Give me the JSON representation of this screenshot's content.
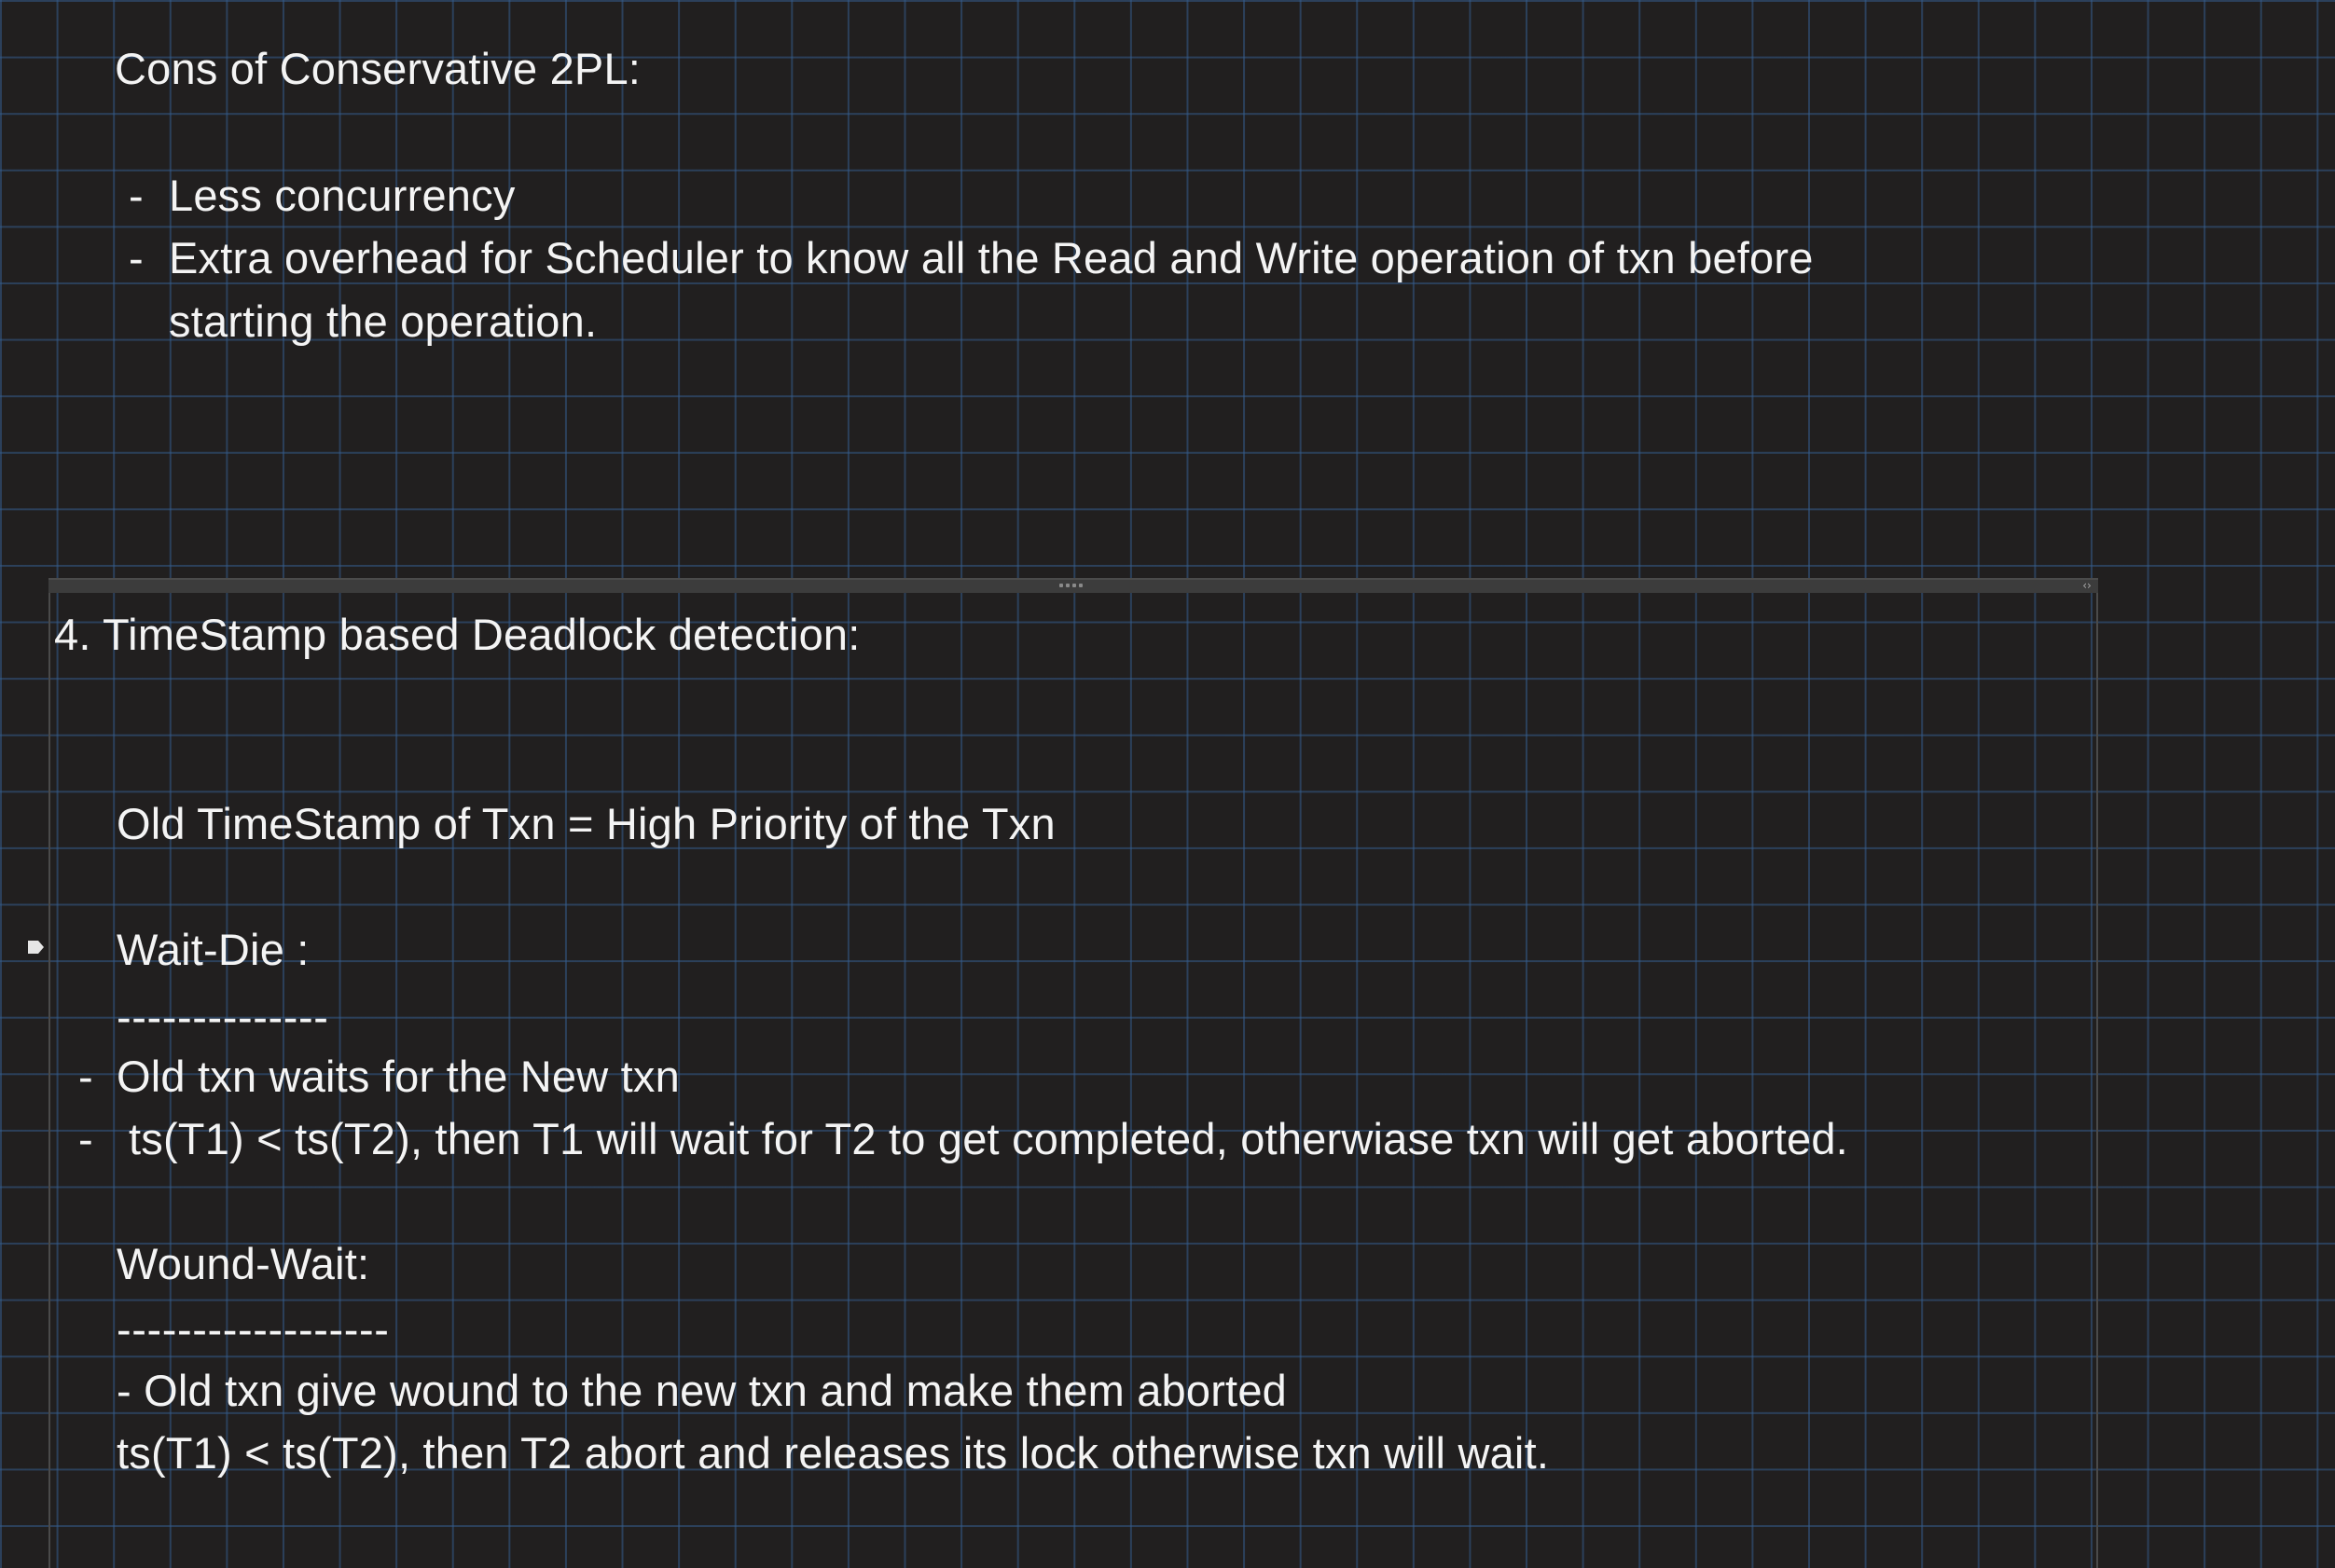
{
  "note": {
    "cons_heading": "Cons of Conservative 2PL:",
    "cons_items": [
      "Less concurrency",
      "Extra overhead for Scheduler to know all the Read and Write operation of txn before",
      "starting the operation."
    ],
    "bullet_dash": "-",
    "section_heading": "4.  TimeStamp based Deadlock detection:",
    "priority_line": "Old TimeStamp of Txn = High Priority of the Txn",
    "wait_die": {
      "heading": "Wait-Die :",
      "underline": "--------------",
      "items": [
        "Old txn waits for the New txn",
        "ts(T1) < ts(T2), then T1 will wait for T2 to get completed, otherwiase txn will get aborted."
      ]
    },
    "wound_wait": {
      "heading": "Wound-Wait:",
      "underline": "------------------",
      "lines": [
        "- Old txn give wound to the new txn and make them aborted",
        "ts(T1) < ts(T2), then T2 abort and releases its lock otherwise txn will wait."
      ]
    }
  },
  "colors": {
    "background": "#211f1f",
    "grid": "#345c8c",
    "text": "#f4f4f4"
  },
  "icons": {
    "container_grip": "grip-dots-icon",
    "container_resize": "resize-arrows-icon",
    "paragraph_marker": "paragraph-marker-icon"
  }
}
